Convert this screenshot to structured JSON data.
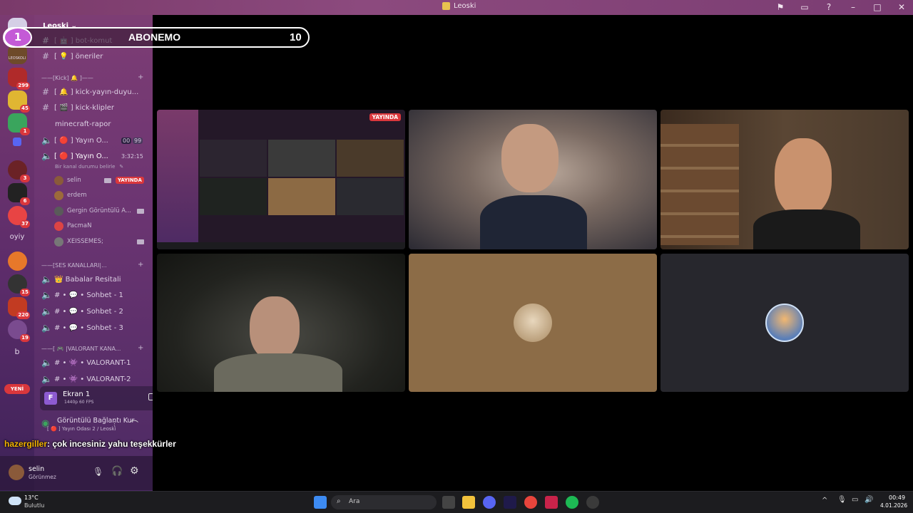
{
  "window": {
    "title": "Leoski"
  },
  "overlay": {
    "level": "1",
    "label": "ABONEMO",
    "count": "10"
  },
  "chat_overlay": {
    "username": "hazergiller",
    "message": ": çok incesiniz yahu teşekkürler"
  },
  "guilds": [
    {
      "name": "leoskoli",
      "label": "LEOSKOLI",
      "badge": ""
    },
    {
      "name": "server-2",
      "badge": "299"
    },
    {
      "name": "server-3",
      "badge": "45"
    },
    {
      "name": "server-4",
      "badge": "1"
    },
    {
      "name": "server-5",
      "badge": ""
    },
    {
      "name": "server-6",
      "badge": "3"
    },
    {
      "name": "server-7",
      "badge": "6"
    },
    {
      "name": "server-8",
      "badge": "37"
    },
    {
      "name": "server-9",
      "badge": ""
    },
    {
      "name": "server-10",
      "badge": "15"
    },
    {
      "name": "server-11",
      "badge": "220"
    },
    {
      "name": "server-12",
      "badge": "19"
    }
  ],
  "guild_text": {
    "oyiy": "oyiy",
    "b": "b",
    "new": "YENİ"
  },
  "sidebar": {
    "server_name": "Leoski",
    "channels": {
      "bot_komut": "[ 🤖 ] bot-komut",
      "oneriler": "[ 💡 ] öneriler",
      "cat_kick": "——[Kick] 🔔 ]——",
      "kick_yayin": "[ 🔔 ] kick-yayın-duyu...",
      "kick_klipler": "[ 🎬 ] kick-klipler",
      "minecraft": "minecraft-rapor",
      "yayin_1": "[ 🔴 ] Yayın O...",
      "yayin_1_count_a": "00",
      "yayin_1_count_b": "99",
      "yayin_2": "[ 🔴 ] Yayın O...",
      "yayin_2_timer": "3:32:15",
      "status_hint": "Bir kanal durumu belirle",
      "cat_ses": "——[SES KANALLARI|...",
      "babalar": "👑 Babalar Resitali",
      "sohbet_1": "# • 💬 • Sohbet - 1",
      "sohbet_2": "# • 💬 • Sohbet - 2",
      "sohbet_3": "# • 💬 • Sohbet - 3",
      "cat_valorant": "——[ 🎮 |VALORANT KANA...",
      "valorant_1": "# • 👾 • VALORANT-1",
      "valorant_2": "# • 👾 • VALORANT-2"
    },
    "voice_users": [
      {
        "name": "selin",
        "live": "YAYINDA"
      },
      {
        "name": "erdem"
      },
      {
        "name": "Gergin Görüntülü A..."
      },
      {
        "name": "PacmaN"
      },
      {
        "name": "XEISSEMES;"
      }
    ]
  },
  "stream_panel": {
    "title": "Ekran 1",
    "subtitle": "1440p 60 FPS",
    "avatar_letter": "F"
  },
  "voice_panel": {
    "status": "Görüntülü Bağlantı Kur",
    "channel": "[ 🔴 ] Yayın Odası 2 / Leoski"
  },
  "user_panel": {
    "name": "selin",
    "status": "Görünmez"
  },
  "stream_tile": {
    "live_label": "YAYINDA"
  },
  "taskbar": {
    "weather_temp": "13°C",
    "weather_desc": "Bulutlu",
    "search_placeholder": "Ara",
    "time": "00:49",
    "date": "4.01.2026"
  },
  "colors": {
    "live_red": "#da373c",
    "overlay_purple": "#c45ad6",
    "chat_name": "#f4b400"
  }
}
